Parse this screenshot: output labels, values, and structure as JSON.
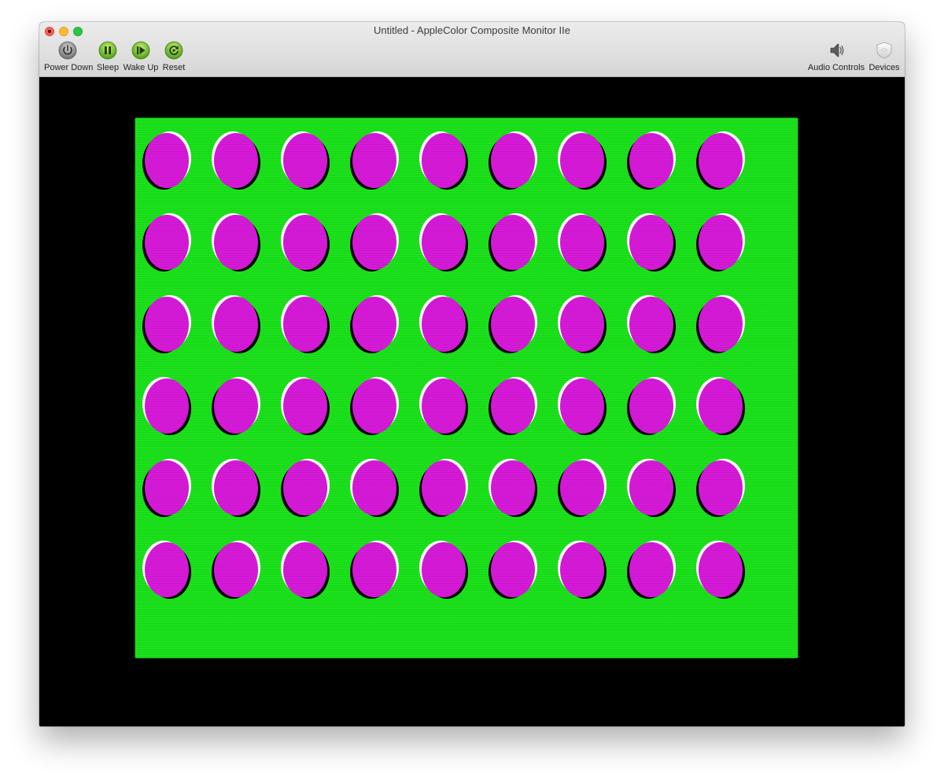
{
  "window": {
    "title": "Untitled - AppleColor Composite Monitor IIe"
  },
  "toolbar": {
    "left": [
      {
        "label": "Power Down",
        "icon": "power-icon"
      },
      {
        "label": "Sleep",
        "icon": "pause-icon"
      },
      {
        "label": "Wake Up",
        "icon": "play-icon"
      },
      {
        "label": "Reset",
        "icon": "reset-icon"
      }
    ],
    "right": [
      {
        "label": "Audio Controls",
        "icon": "speaker-icon"
      },
      {
        "label": "Devices",
        "icon": "shield-icon"
      }
    ]
  },
  "display": {
    "background_color": "#000000",
    "field_color": "#1be21b",
    "dot_color": "#d61ad8",
    "dot_rows": 6,
    "dot_cols": 9,
    "edge_pattern": [
      [
        "W",
        "B",
        "B",
        "W",
        "B",
        "W",
        "B",
        "W",
        "W"
      ],
      [
        "W",
        "B",
        "B",
        "W",
        "B",
        "W",
        "B",
        "B",
        "W"
      ],
      [
        "W",
        "B",
        "B",
        "W",
        "B",
        "W",
        "B",
        "B",
        "W"
      ],
      [
        "B",
        "W",
        "B",
        "W",
        "B",
        "W",
        "B",
        "W",
        "B"
      ],
      [
        "W",
        "B",
        "W",
        "B",
        "W",
        "B",
        "W",
        "B",
        "W"
      ],
      [
        "B",
        "W",
        "B",
        "W",
        "B",
        "W",
        "B",
        "W",
        "B"
      ]
    ]
  }
}
